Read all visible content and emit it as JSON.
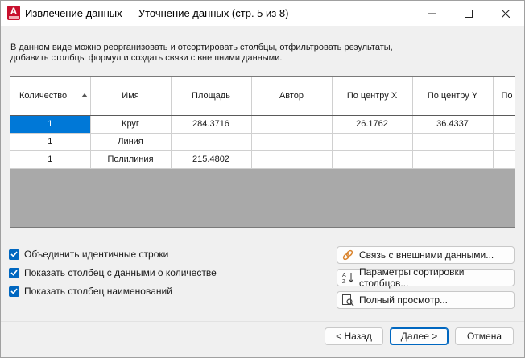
{
  "window": {
    "title": "Извлечение данных — Уточнение данных (стр. 5 из 8)",
    "app_icon_letter": "A"
  },
  "description": {
    "line1": "В данном виде можно реорганизовать и отсортировать столбцы, отфильтровать результаты,",
    "line2": "добавить столбцы формул и создать связи с внешними данными."
  },
  "grid": {
    "columns": [
      "Количество",
      "Имя",
      "Площадь",
      "Автор",
      "По центру X",
      "По центру Y",
      "По"
    ],
    "sorted_column": "Количество",
    "rows": [
      [
        "1",
        "Круг",
        "284.3716",
        "",
        "26.1762",
        "36.4337",
        ""
      ],
      [
        "1",
        "Линия",
        "",
        "",
        "",
        "",
        ""
      ],
      [
        "1",
        "Полилиния",
        "215.4802",
        "",
        "",
        "",
        ""
      ]
    ],
    "selected_cell": "1"
  },
  "options": {
    "combine_rows": "Объединить идентичные строки",
    "show_count_column": "Показать столбец с данными о количестве",
    "show_name_column": "Показать столбец наименований"
  },
  "side_buttons": {
    "link_external": "Связь с внешними данными...",
    "sort_params": "Параметры сортировки столбцов...",
    "full_preview": "Полный просмотр..."
  },
  "nav_buttons": {
    "back": "< Назад",
    "next": "Далее >",
    "cancel": "Отмена"
  },
  "colors": {
    "accent": "#0067c0",
    "selection": "#0078d7",
    "app_icon": "#c8102e",
    "empty_grid_area": "#a9a9a9"
  },
  "icons": {
    "link": "link-icon",
    "sort": "sort-az-icon",
    "preview": "preview-icon",
    "checkbox": "checkmark-icon"
  }
}
